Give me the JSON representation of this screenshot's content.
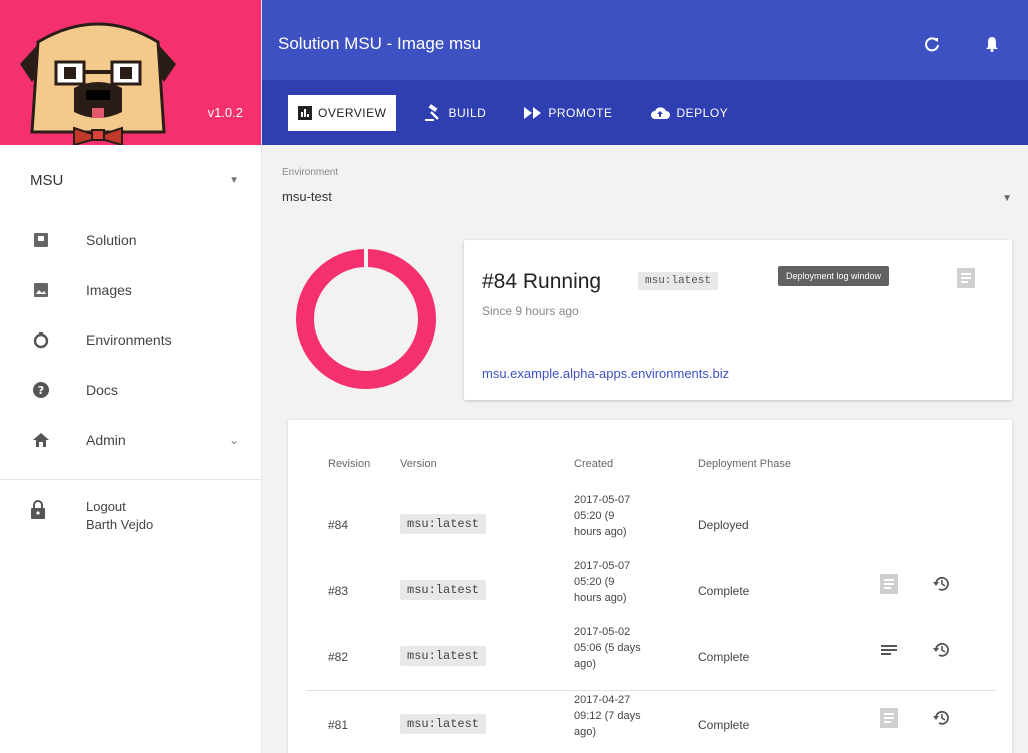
{
  "app": {
    "version": "v1.0.2",
    "selector_value": "MSU"
  },
  "header": {
    "title": "Solution MSU - Image msu"
  },
  "tabs": [
    {
      "label": "OVERVIEW",
      "active": true
    },
    {
      "label": "BUILD",
      "active": false
    },
    {
      "label": "PROMOTE",
      "active": false
    },
    {
      "label": "DEPLOY",
      "active": false
    }
  ],
  "sidebar": {
    "items": [
      {
        "label": "Solution",
        "icon": "solution-icon"
      },
      {
        "label": "Images",
        "icon": "image-icon"
      },
      {
        "label": "Environments",
        "icon": "environment-icon"
      },
      {
        "label": "Docs",
        "icon": "help-icon"
      },
      {
        "label": "Admin",
        "icon": "home-icon"
      }
    ],
    "logout": {
      "label": "Logout",
      "user": "Barth Vejdo"
    }
  },
  "environment": {
    "label": "Environment",
    "value": "msu-test"
  },
  "status": {
    "title": "#84 Running",
    "tag": "msu:latest",
    "since": "Since 9 hours ago",
    "link": "msu.example.alpha-apps.environments.biz",
    "tooltip": "Deployment log window",
    "donut_color": "#f5306e"
  },
  "history": {
    "columns": [
      "Revision",
      "Version",
      "Created",
      "Deployment Phase"
    ],
    "rows": [
      {
        "revision": "#84",
        "version": "msu:latest",
        "created": "2017-05-07 05:20 (9 hours ago)",
        "phase": "Deployed",
        "actions": false
      },
      {
        "revision": "#83",
        "version": "msu:latest",
        "created": "2017-05-07 05:20 (9 hours ago)",
        "phase": "Complete",
        "actions": true
      },
      {
        "revision": "#82",
        "version": "msu:latest",
        "created": "2017-05-02 05:06 (5 days ago)",
        "phase": "Complete",
        "actions": true
      },
      {
        "revision": "#81",
        "version": "msu:latest",
        "created": "2017-04-27 09:12 (7 days ago)",
        "phase": "Complete",
        "actions": true
      }
    ]
  },
  "colors": {
    "brand_pink": "#f5306e",
    "header_blue": "#3e51c2",
    "tab_blue": "#2f3fb1"
  }
}
